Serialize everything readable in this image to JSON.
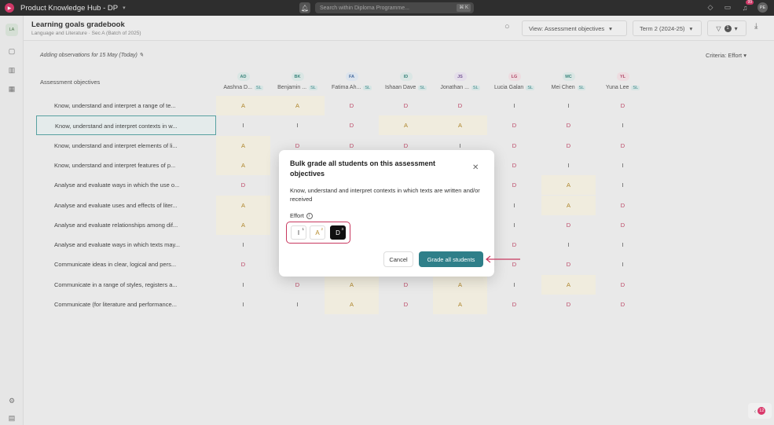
{
  "app": {
    "title": "Product Knowledge Hub - DP",
    "avatar": "PE",
    "notif_count": "99"
  },
  "search": {
    "placeholder": "Search within Diploma Programme...",
    "shortcut": "⌘ K"
  },
  "rail": {
    "avatar": "LA"
  },
  "header": {
    "title": "Learning goals gradebook",
    "subtitle": "Language and Literature · Sec A (Batch of 2025)",
    "view_label": "View: Assessment objectives",
    "term_label": "Term 2 (2024-25)",
    "filter_count": "1"
  },
  "subheader": {
    "observations": "Adding observations for 15 May (Today)",
    "criteria": "Criteria: Effort"
  },
  "table": {
    "objective_header": "Assessment objectives",
    "students": [
      {
        "initials": "AD",
        "name": "Aashna D...",
        "sl": "SL",
        "bg": "#e4f1ef",
        "fg": "#3b8a80"
      },
      {
        "initials": "BK",
        "name": "Benjamin ...",
        "sl": "SL",
        "bg": "#e4f1ef",
        "fg": "#3b8a80"
      },
      {
        "initials": "FA",
        "name": "Fatima Ah...",
        "sl": "SL",
        "bg": "#e6eef8",
        "fg": "#4a6fa5"
      },
      {
        "initials": "ID",
        "name": "Ishaan Dave",
        "sl": "SL",
        "bg": "#e4f1ef",
        "fg": "#3b8a80"
      },
      {
        "initials": "JS",
        "name": "Jonathan ...",
        "sl": "SL",
        "bg": "#efe8f5",
        "fg": "#7a5a9a"
      },
      {
        "initials": "LG",
        "name": "Lucia Galan",
        "sl": "SL",
        "bg": "#f8e6ea",
        "fg": "#b8486a"
      },
      {
        "initials": "MC",
        "name": "Mei Chen",
        "sl": "SL",
        "bg": "#e4f1ef",
        "fg": "#3b8a80"
      },
      {
        "initials": "YL",
        "name": "Yuna Lee",
        "sl": "SL",
        "bg": "#f8e6ea",
        "fg": "#b8486a"
      }
    ],
    "rows": [
      {
        "objective": "Know, understand and interpret a range of te...",
        "grades": [
          "A",
          "A",
          "D",
          "D",
          "D",
          "I",
          "I",
          "D"
        ]
      },
      {
        "objective": "Know, understand and interpret contexts in w...",
        "grades": [
          "I",
          "I",
          "D",
          "A",
          "A",
          "D",
          "D",
          "I"
        ],
        "selected": true
      },
      {
        "objective": "Know, understand and interpret elements of li...",
        "grades": [
          "A",
          "D",
          "D",
          "D",
          "I",
          "D",
          "D",
          "D"
        ]
      },
      {
        "objective": "Know, understand and interpret features of p...",
        "grades": [
          "A",
          "",
          "",
          "",
          "",
          "D",
          "I",
          "I"
        ]
      },
      {
        "objective": "Analyse and evaluate ways in which the use o...",
        "grades": [
          "D",
          "",
          "",
          "",
          "",
          "D",
          "A",
          "I"
        ]
      },
      {
        "objective": "Analyse and evaluate uses and effects of liter...",
        "grades": [
          "A",
          "",
          "",
          "",
          "",
          "I",
          "A",
          "D"
        ]
      },
      {
        "objective": "Analyse and evaluate relationships among dif...",
        "grades": [
          "A",
          "",
          "",
          "",
          "",
          "I",
          "D",
          "D"
        ]
      },
      {
        "objective": "Analyse and evaluate ways in which texts may...",
        "grades": [
          "I",
          "",
          "",
          "",
          "",
          "D",
          "I",
          "I"
        ]
      },
      {
        "objective": "Communicate ideas in clear, logical and pers...",
        "grades": [
          "D",
          "",
          "",
          "",
          "",
          "D",
          "D",
          "I"
        ]
      },
      {
        "objective": "Communicate in a range of styles, registers a...",
        "grades": [
          "I",
          "D",
          "A",
          "D",
          "A",
          "I",
          "A",
          "D"
        ]
      },
      {
        "objective": "Communicate (for literature and performance...",
        "grades": [
          "I",
          "I",
          "A",
          "D",
          "A",
          "D",
          "D",
          "D"
        ]
      }
    ]
  },
  "modal": {
    "title": "Bulk grade all students on this assessment objectives",
    "description": "Know, understand and interpret contexts in which texts are written and/or received",
    "effort_label": "Effort",
    "options": [
      {
        "label": "I",
        "sup": "1",
        "color": "#555555"
      },
      {
        "label": "A",
        "sup": "2",
        "color": "#b58a2a"
      },
      {
        "label": "D",
        "sup": "3",
        "color": "#ffffff",
        "selected": true
      }
    ],
    "cancel": "Cancel",
    "confirm": "Grade all students"
  },
  "bottom_chip": {
    "count": "12"
  },
  "colors": {
    "accent": "#2f7f89",
    "highlight": "#c8385f"
  }
}
